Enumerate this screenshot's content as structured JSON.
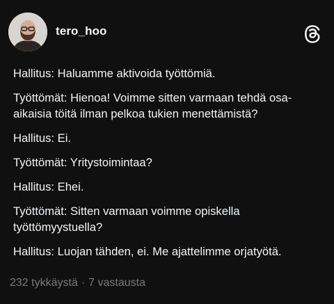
{
  "post": {
    "username": "tero_hoo",
    "lines": [
      "Hallitus: Haluamme aktivoida työttömiä.",
      "Työttömät: Hienoa! Voimme sitten varmaan tehdä osa-aikaisia töitä ilman pelkoa tukien menettämistä?",
      "Hallitus: Ei.",
      "Työttömät: Yritystoimintaa?",
      "Hallitus: Ehei.",
      "Työttömät: Sitten varmaan voimme opiskella työttömyystuella?",
      "Hallitus: Luojan tähden, ei. Me ajattelimme orjatyötä."
    ],
    "likes": "232 tykkäystä",
    "separator": "·",
    "replies": "7 vastausta"
  },
  "icons": {
    "app": "threads-logo-icon",
    "avatar": "user-avatar"
  },
  "colors": {
    "background": "#101010",
    "text": "#f3f5f7",
    "muted": "#7a7a7a"
  }
}
